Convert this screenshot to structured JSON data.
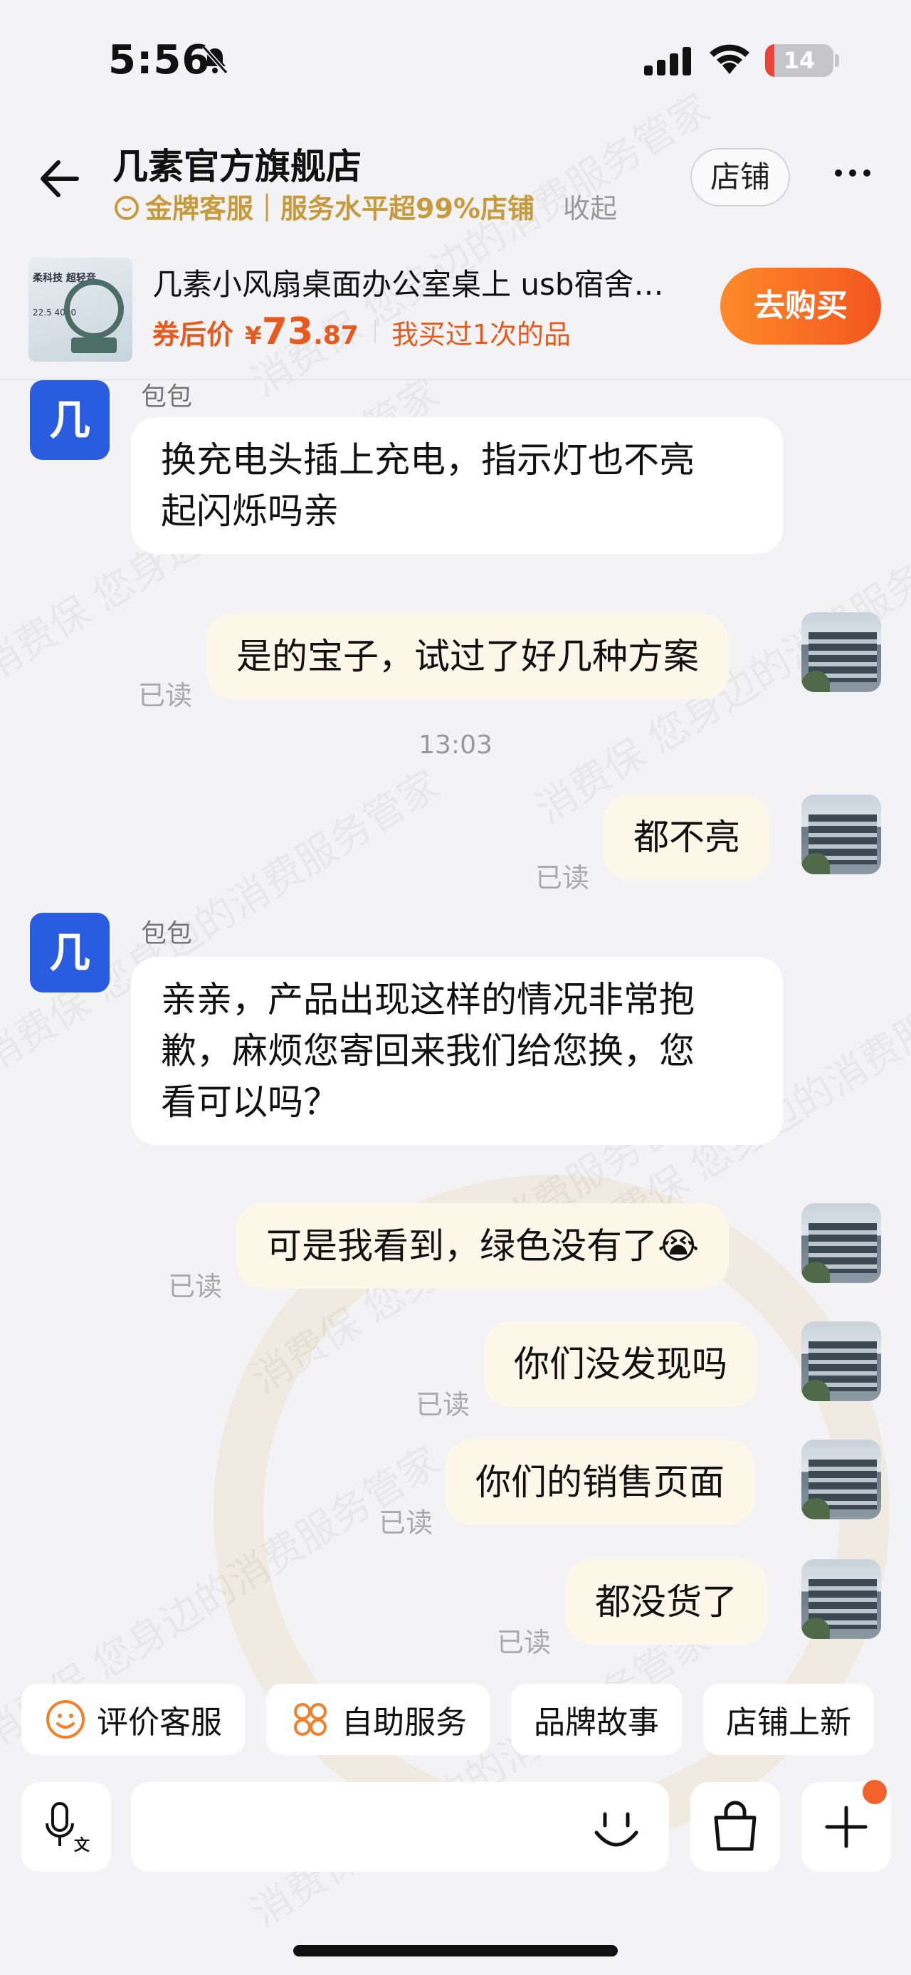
{
  "status_bar": {
    "time": "5:56",
    "battery": "14",
    "battery_level": 0.14
  },
  "header": {
    "shop_name": "几素官方旗舰店",
    "service_badge": "金牌客服｜服务水平超99%店铺",
    "collapse_label": "收起",
    "store_button": "店铺"
  },
  "product": {
    "title": "几素小风扇桌面办公室桌上 usb宿舍…",
    "price_label": "券后价",
    "currency": "¥",
    "price_int": "73",
    "price_dec": ".87",
    "bought": "我买过1次的品",
    "buy_button": "去购买",
    "thumb_text_1": "柔科技 超轻音",
    "thumb_text_2": "22.5 4000"
  },
  "watermark": {
    "text": "消费保 您身边的消费服务管家"
  },
  "messages": {
    "m1": {
      "sender": "包包",
      "avatar": "几",
      "text_line1": "换充电头插上充电，指示灯也不亮",
      "text_line2": "起闪烁吗亲"
    },
    "m2": {
      "text": "是的宝子，试过了好几种方案",
      "read": "已读"
    },
    "timestamp": "13:03",
    "m3": {
      "text": "都不亮",
      "read": "已读"
    },
    "m4": {
      "sender": "包包",
      "avatar": "几",
      "text_line1": "亲亲，产品出现这样的情况非常抱",
      "text_line2": "歉，麻烦您寄回来我们给您换，您",
      "text_line3": "看可以吗？"
    },
    "m5": {
      "text": "可是我看到，绿色没有了😭",
      "read": "已读"
    },
    "m6": {
      "text": "你们没发现吗",
      "read": "已读"
    },
    "m7": {
      "text": "你们的销售页面",
      "read": "已读"
    },
    "m8": {
      "text": "都没货了",
      "read": "已读"
    }
  },
  "quick_actions": [
    {
      "label": "评价客服",
      "icon": "smile-icon"
    },
    {
      "label": "自助服务",
      "icon": "grid-icon"
    },
    {
      "label": "品牌故事"
    },
    {
      "label": "店铺上新"
    }
  ],
  "input_bar": {
    "voice_icon": "voice-translate-icon",
    "emoji_icon": "emoji-icon",
    "bag_icon": "shopping-bag-icon",
    "plus_icon": "plus-icon"
  },
  "colors": {
    "accent": "#f2561e",
    "gold": "#c79a3e",
    "shop_avatar": "#2a5ce0",
    "out_bubble": "#fdf7e9"
  }
}
